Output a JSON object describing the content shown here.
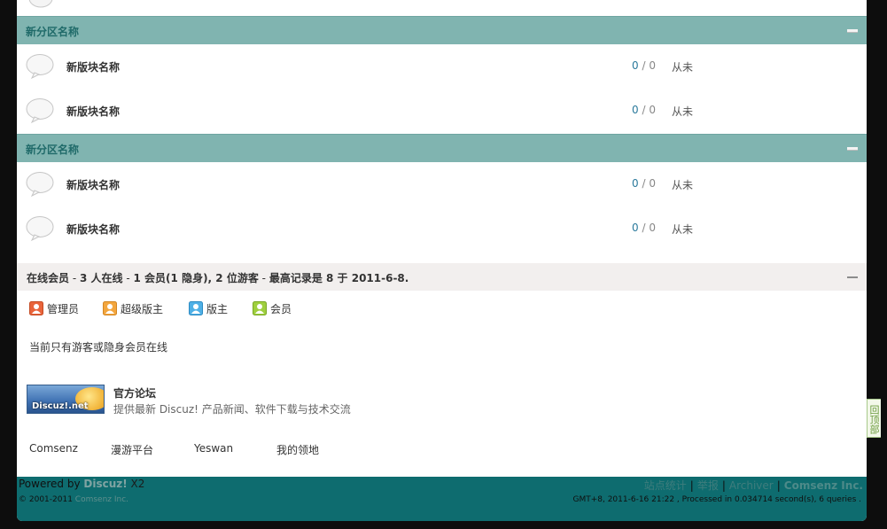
{
  "categories": [
    {
      "title": "新分区名称",
      "forums": [
        {
          "name": "新版块名称",
          "threads": "0",
          "sep": "/",
          "posts": "0",
          "last": "从未"
        },
        {
          "name": "新版块名称",
          "threads": "0",
          "sep": "/",
          "posts": "0",
          "last": "从未"
        }
      ]
    },
    {
      "title": "新分区名称",
      "forums": [
        {
          "name": "新版块名称",
          "threads": "0",
          "sep": "/",
          "posts": "0",
          "last": "从未"
        },
        {
          "name": "新版块名称",
          "threads": "0",
          "sep": "/",
          "posts": "0",
          "last": "从未"
        }
      ]
    }
  ],
  "online": {
    "label": "在线会员",
    "dash1": " - ",
    "online_count": "3",
    "online_text": " 人在线",
    "dash2": " - ",
    "members": "1",
    "members_text": " 会员(",
    "hidden": "1",
    "hidden_text": " 隐身), ",
    "guests": "2",
    "guests_text": " 位游客",
    "dash3": " - ",
    "record_text": "最高记录是 ",
    "record": "8",
    "record_yu": " 于 ",
    "record_date": "2011-6-8",
    "period": ".",
    "legend": [
      "管理员",
      "超级版主",
      "版主",
      "会员"
    ],
    "message": "当前只有游客或隐身会员在线"
  },
  "friend_link": {
    "logo_text": "Discuz!.net",
    "title": "官方论坛",
    "description": "提供最新 Discuz! 产品新闻、软件下载与技术交流"
  },
  "text_links": [
    "Comsenz",
    "漫游平台",
    "Yeswan",
    "我的领地"
  ],
  "footer": {
    "powered": "Powered by ",
    "brand": "Discuz!",
    "version": " X2",
    "copyright": "© 2001-2011 ",
    "company": "Comsenz Inc.",
    "links": [
      "站点统计",
      "举报",
      "Archiver",
      "Comsenz Inc."
    ],
    "gmt": "GMT+8, 2011-6-16 21:22 , Processed in 0.034714 second(s), 6 queries ."
  },
  "back_to_top": "回顶部",
  "colors": {
    "category_bar": "#80b4b0",
    "category_title": "#1f6a69",
    "footer_bg": "#0e6c6f",
    "count_blue": "#2b7a9c"
  }
}
